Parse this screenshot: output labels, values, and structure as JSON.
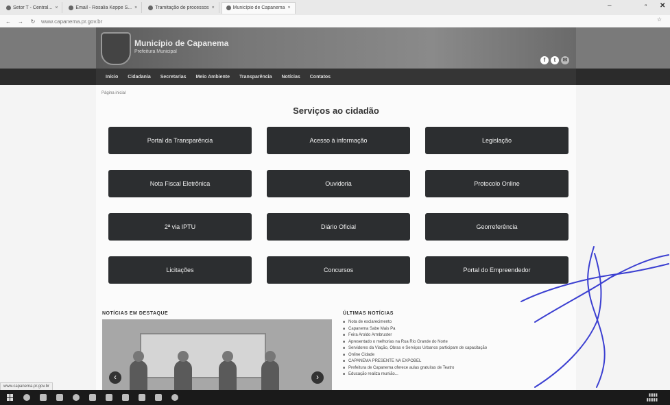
{
  "browser": {
    "tabs": [
      {
        "label": "Setor T - Central..."
      },
      {
        "label": "Email - Rosalia Keppe S..."
      },
      {
        "label": "Tramitação de processos"
      },
      {
        "label": "Município de Capanema"
      }
    ],
    "url": "www.capanema.pr.gov.br"
  },
  "site": {
    "title": "Município de Capanema",
    "subtitle": "Prefeitura Municipal",
    "menu": [
      "Início",
      "Cidadania",
      "Secretarias",
      "Meio Ambiente",
      "Transparência",
      "Notícias",
      "Contatos"
    ],
    "breadcrumb": "Página inicial"
  },
  "services": {
    "heading": "Serviços ao cidadão",
    "buttons": [
      "Portal da Transparência",
      "Acesso à informação",
      "Legislação",
      "Nota Fiscal Eletrônica",
      "Ouvidoria",
      "Protocolo Online",
      "2ª via IPTU",
      "Diário Oficial",
      "Georreferência",
      "Licitações",
      "Concursos",
      "Portal do Empreendedor"
    ]
  },
  "news": {
    "featured_heading": "NOTÍCIAS EM DESTAQUE",
    "latest_heading": "ÚLTIMAS NOTÍCIAS",
    "latest": [
      "Nota de esclarecimento",
      "Capanema Sabe Mais Pa",
      "Feira Aroldo Armbruster",
      "Apresentado o melhorias na Rua Rio Grande do Norte",
      "Servidores da Viação, Obras e Serviços Urbanos participam de capacitação",
      "Online Cidade",
      "CAPANEMA PRESENTE NA EXPOBEL",
      "Prefeitura de Capanema oferece aulas gratuitas de Teatro",
      "Educação realiza reunião..."
    ]
  },
  "status_url": "www.capanema.pr.gov.br"
}
